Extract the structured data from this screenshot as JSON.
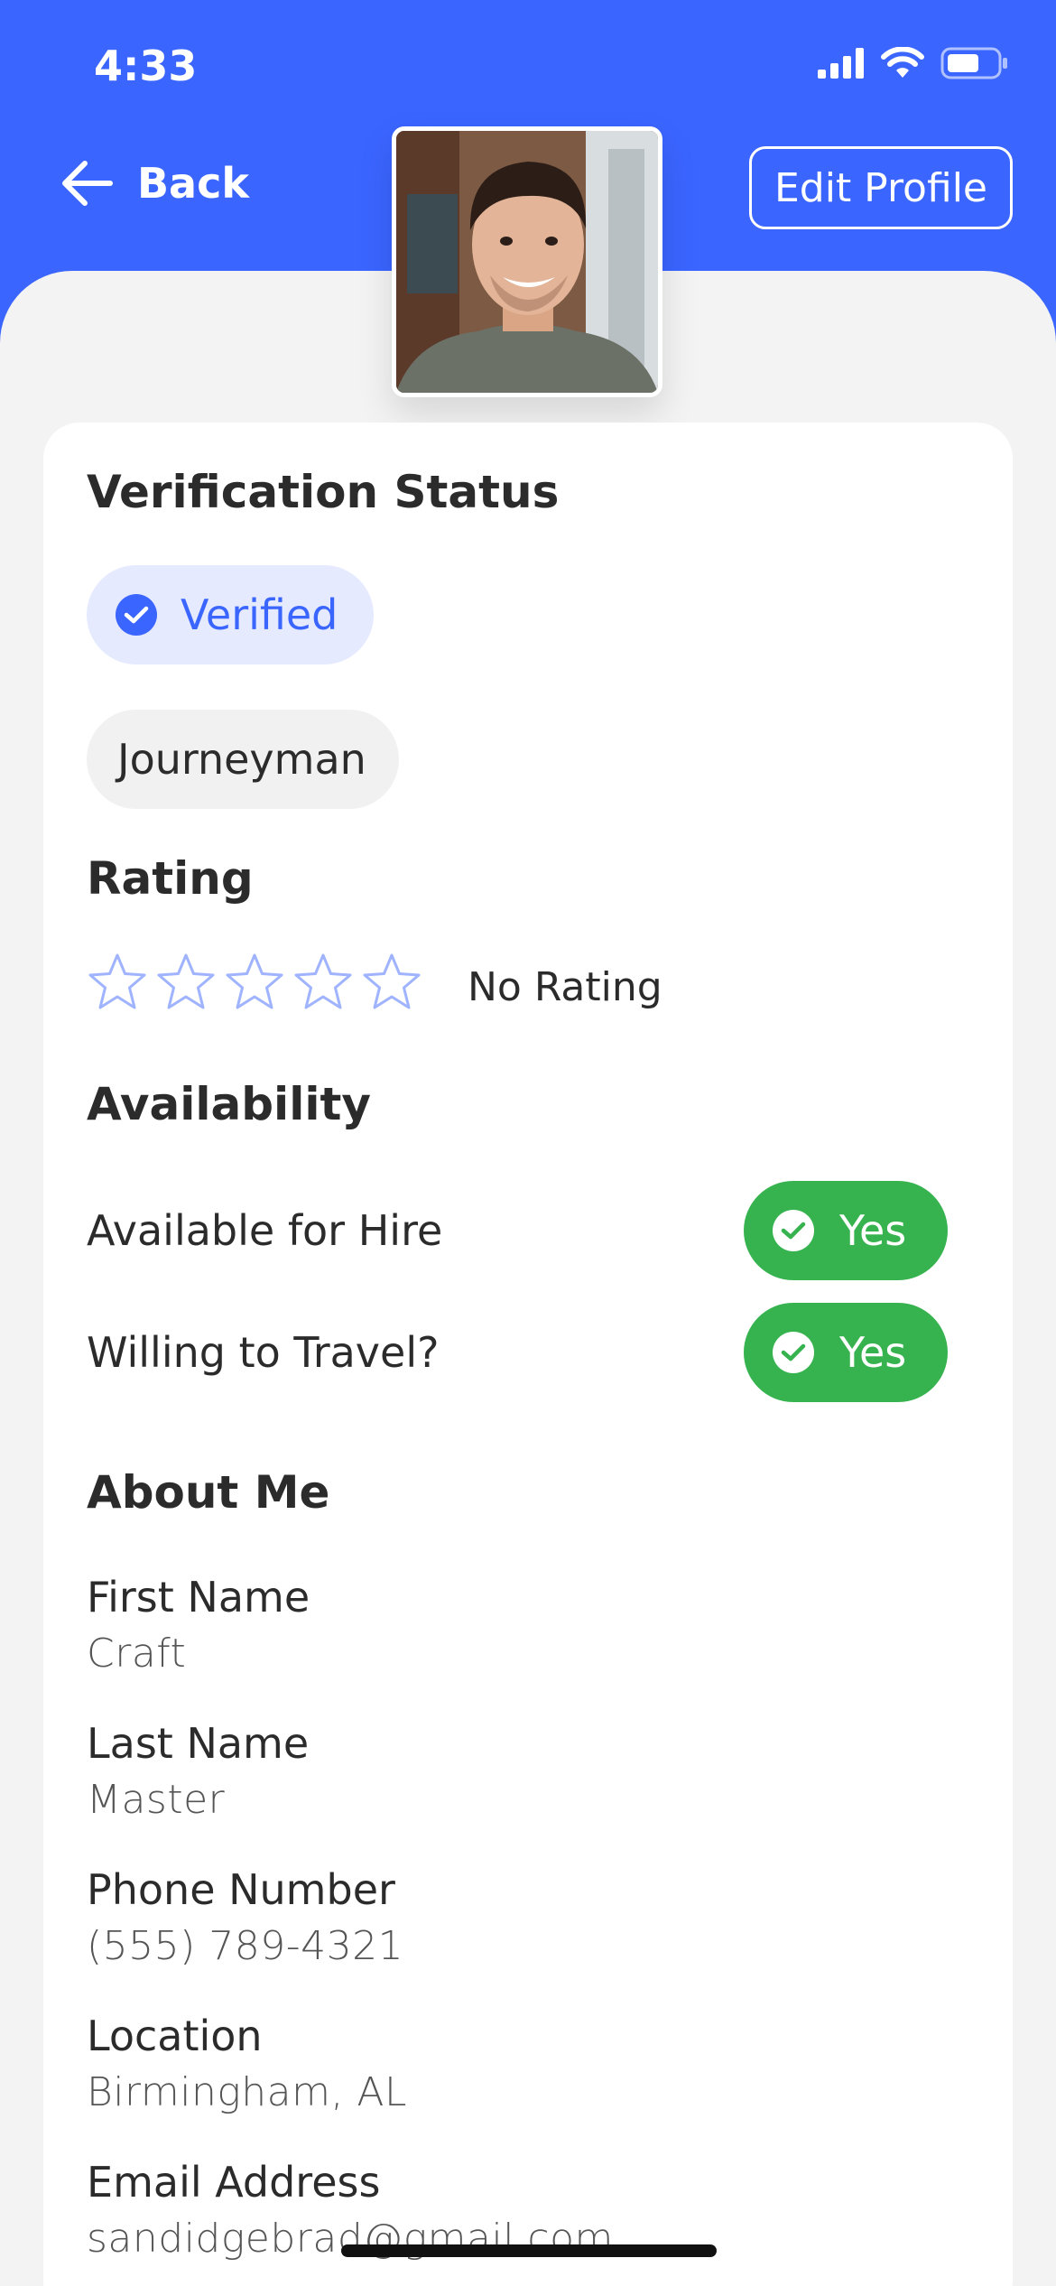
{
  "status_bar": {
    "time": "4:33"
  },
  "nav": {
    "back_label": "Back",
    "edit_label": "Edit Profile"
  },
  "colors": {
    "brand": "#3a65ff",
    "success": "#36b34f",
    "star": "#9fb3ff"
  },
  "verification": {
    "title": "Verification Status",
    "status_label": "Verified",
    "level_label": "Journeyman"
  },
  "rating": {
    "title": "Rating",
    "stars_filled": 0,
    "stars_total": 5,
    "text": "No Rating"
  },
  "availability": {
    "title": "Availability",
    "items": [
      {
        "label": "Available for Hire",
        "value": "Yes"
      },
      {
        "label": "Willing to Travel?",
        "value": "Yes"
      }
    ]
  },
  "about": {
    "title": "About Me",
    "fields": [
      {
        "label": "First Name",
        "value": "Craft"
      },
      {
        "label": "Last Name",
        "value": "Master"
      },
      {
        "label": "Phone Number",
        "value": "(555) 789-4321"
      },
      {
        "label": "Location",
        "value": "Birmingham, AL"
      },
      {
        "label": "Email Address",
        "value": "sandidgebrad@gmail.com"
      }
    ]
  }
}
